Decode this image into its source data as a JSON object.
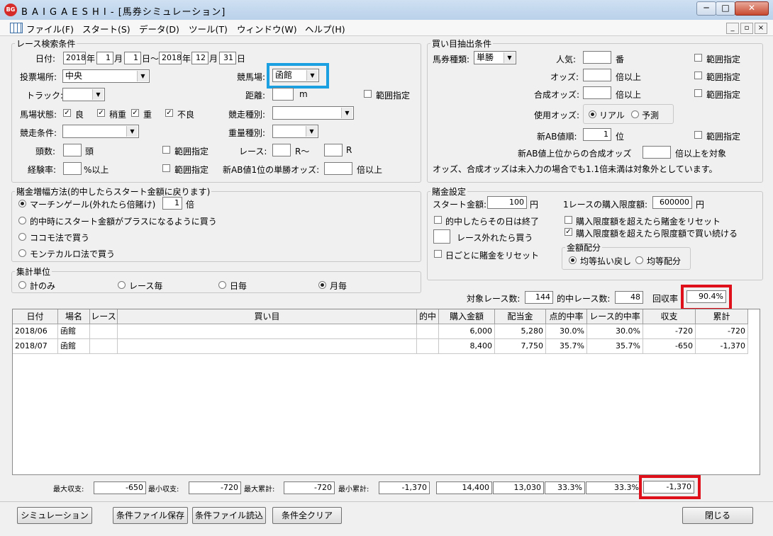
{
  "window": {
    "title": "B A I G A E S H I - [馬券シミュレーション]",
    "icon_text": "BG",
    "controls": [
      "─",
      "□",
      "✕"
    ]
  },
  "menu": {
    "items": [
      "ファイル(F)",
      "スタート(S)",
      "データ(D)",
      "ツール(T)",
      "ウィンドウ(W)",
      "ヘルプ(H)"
    ],
    "mdi": [
      "_",
      "▫",
      "×"
    ]
  },
  "race_search": {
    "legend": "レース検索条件",
    "date_label": "日付:",
    "y1": "2018",
    "nen1": "年",
    "m1": "1",
    "tsuki1": "月",
    "d1": "1",
    "nichi1": "日〜",
    "y2": "2018",
    "nen2": "年",
    "m2": "12",
    "tsuki2": "月",
    "d2": "31",
    "nichi2": "日",
    "place_label": "投票場所:",
    "place": "中央",
    "course_label": "競馬場:",
    "course": "函館",
    "track_label": "トラック:",
    "track": "",
    "distance_label": "距離:",
    "distance": "",
    "distance_unit": "m",
    "distance_range": "範囲指定",
    "condition_label": "馬場状態:",
    "cond": [
      "良",
      "稍重",
      "重",
      "不良"
    ],
    "race_type_label": "競走種別:",
    "race_type": "",
    "race_cond_label": "競走条件:",
    "race_cond": "",
    "weight_label": "重量種別:",
    "weight": "",
    "heads_label": "頭数:",
    "heads": "",
    "heads_unit": "頭",
    "heads_range": "範囲指定",
    "race_label": "レース:",
    "race_from": "",
    "race_tilde": "R〜",
    "race_to": "",
    "race_r": "R",
    "exp_label": "経験率:",
    "exp": "",
    "exp_unit": "%以上",
    "exp_range": "範囲指定",
    "ab_odds_label": "新AB値1位の単勝オッズ:",
    "ab_odds": "",
    "ab_odds_unit": "倍以上"
  },
  "buy_cond": {
    "legend": "買い目抽出条件",
    "ticket_label": "馬券種類:",
    "ticket": "単勝",
    "pop_label": "人気:",
    "pop": "",
    "pop_unit": "番",
    "pop_range": "範囲指定",
    "odds_label": "オッズ:",
    "odds": "",
    "odds_unit": "倍以上",
    "odds_range": "範囲指定",
    "comb_label": "合成オッズ:",
    "comb": "",
    "comb_unit": "倍以上",
    "comb_range": "範囲指定",
    "use_odds_label": "使用オッズ:",
    "real": "リアル",
    "forecast": "予測",
    "ab_rank_label": "新AB値順:",
    "ab_rank": "1",
    "ab_rank_unit": "位",
    "ab_rank_range": "範囲指定",
    "ab_top_label": "新AB値上位からの合成オッズ",
    "ab_top": "",
    "ab_top_unit": "倍以上を対象",
    "note": "オッズ、合成オッズは未入力の場合でも1.1倍未満は対象外としています。"
  },
  "bet_inc": {
    "legend": "賭金増幅方法(的中したらスタート金額に戻ります)",
    "opt1": "マーチンゲール(外れたら倍賭け)",
    "mult": "1",
    "mult_unit": "倍",
    "opt2": "的中時にスタート金額がプラスになるように買う",
    "opt3": "ココモ法で買う",
    "opt4": "モンテカルロ法で買う"
  },
  "bet_set": {
    "legend": "賭金設定",
    "start_label": "スタート金額:",
    "start": "100",
    "start_unit": "円",
    "limit_label": "1レースの購入限度額:",
    "limit": "600000",
    "limit_unit": "円",
    "end_on_hit": "的中したらその日は終了",
    "reset_over": "購入限度額を超えたら賭金をリセット",
    "buy_on_miss": "レース外れたら買う",
    "keep_limit": "購入限度額を超えたら限度額で買い続ける",
    "reset_daily": "日ごとに賭金をリセット",
    "alloc_legend": "金額配分",
    "alloc1": "均等払い戻し",
    "alloc2": "均等配分"
  },
  "agg": {
    "legend": "集計単位",
    "opts": [
      "計のみ",
      "レース毎",
      "日毎",
      "月毎"
    ]
  },
  "stats": {
    "target_label": "対象レース数:",
    "target": "144",
    "hit_label": "的中レース数:",
    "hit": "48",
    "recovery_label": "回収率",
    "recovery": "90.4%"
  },
  "table": {
    "headers": [
      "日付",
      "場名",
      "レース",
      "買い目",
      "的中",
      "購入金額",
      "配当金",
      "点的中率",
      "レース的中率",
      "収支",
      "累計"
    ],
    "rows": [
      [
        "2018/06",
        "函館",
        "",
        "",
        "",
        "6,000",
        "5,280",
        "30.0%",
        "30.0%",
        "-720",
        "-720"
      ],
      [
        "2018/07",
        "函館",
        "",
        "",
        "",
        "8,400",
        "7,750",
        "35.7%",
        "35.7%",
        "-650",
        "-1,370"
      ]
    ]
  },
  "summary": {
    "max_inc_label": "最大収支:",
    "max_inc": "-650",
    "min_inc_label": "最小収支:",
    "min_inc": "-720",
    "max_cum_label": "最大累計:",
    "max_cum": "-720",
    "min_cum_label": "最小累計:",
    "min_cum": "-1,370",
    "buy": "14,400",
    "payout": "13,030",
    "pt_rate": "33.3%",
    "race_rate": "33.3%",
    "cum": "-1,370"
  },
  "buttons": {
    "simulate": "シミュレーション",
    "save": "条件ファイル保存",
    "load": "条件ファイル読込",
    "clear": "条件全クリア",
    "close": "閉じる"
  },
  "colors": {
    "highlight_blue": "#1ba1e2",
    "highlight_red": "#e0101a"
  }
}
